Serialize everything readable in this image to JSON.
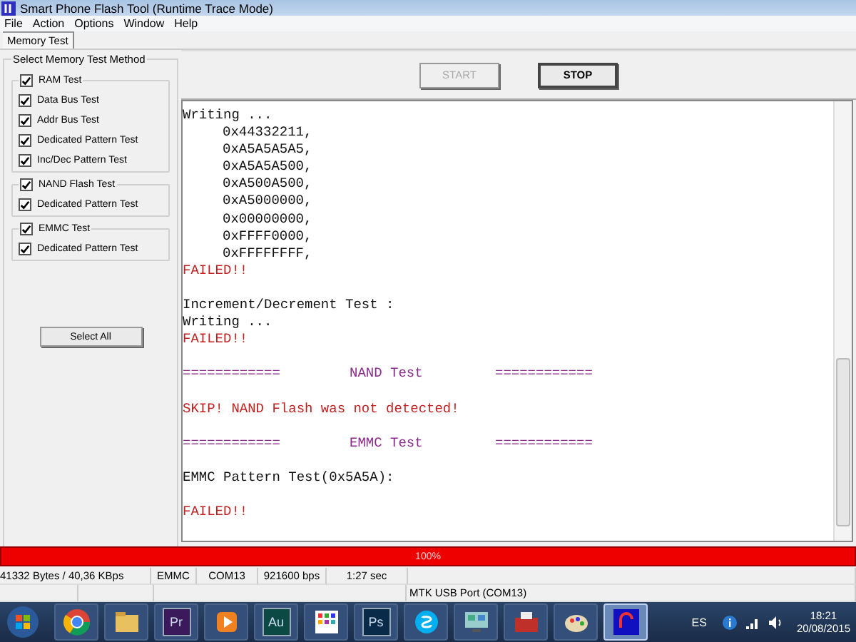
{
  "window": {
    "title": "Smart Phone Flash Tool (Runtime Trace Mode)"
  },
  "menu": [
    "File",
    "Action",
    "Options",
    "Window",
    "Help"
  ],
  "tabs": [
    {
      "label": "Memory Test",
      "selected": true
    }
  ],
  "method_panel": {
    "title": "Select Memory Test Method",
    "groups": [
      {
        "label": "RAM Test",
        "checked": true,
        "items": [
          {
            "label": "Data Bus Test",
            "checked": true
          },
          {
            "label": "Addr Bus Test",
            "checked": true
          },
          {
            "label": "Dedicated Pattern Test",
            "checked": true
          },
          {
            "label": "Inc/Dec Pattern Test",
            "checked": true
          }
        ]
      },
      {
        "label": "NAND Flash Test",
        "checked": true,
        "items": [
          {
            "label": "Dedicated Pattern Test",
            "checked": true
          }
        ]
      },
      {
        "label": "EMMC Test",
        "checked": true,
        "items": [
          {
            "label": "Dedicated Pattern Test",
            "checked": true
          }
        ]
      }
    ],
    "select_all": "Select All"
  },
  "buttons": [
    {
      "label": "START",
      "disabled": true
    },
    {
      "label": "STOP",
      "disabled": false
    }
  ],
  "log": [
    {
      "kind": "text",
      "text": "Writing ..."
    },
    {
      "kind": "value",
      "text": "0x44332211,"
    },
    {
      "kind": "value",
      "text": "0xA5A5A5A5,"
    },
    {
      "kind": "value",
      "text": "0xA5A5A500,"
    },
    {
      "kind": "value",
      "text": "0xA500A500,"
    },
    {
      "kind": "value",
      "text": "0xA5000000,"
    },
    {
      "kind": "value",
      "text": "0x00000000,"
    },
    {
      "kind": "value",
      "text": "0xFFFF0000,"
    },
    {
      "kind": "value",
      "text": "0xFFFFFFFF,"
    },
    {
      "kind": "error",
      "text": "FAILED!!"
    },
    {
      "kind": "spacer"
    },
    {
      "kind": "text",
      "text": "Increment/Decrement Test :"
    },
    {
      "kind": "text",
      "text": "Writing ..."
    },
    {
      "kind": "error",
      "text": "FAILED!!"
    },
    {
      "kind": "spacer"
    },
    {
      "kind": "header",
      "left": "============",
      "title": "NAND Test",
      "right": "============"
    },
    {
      "kind": "spacer"
    },
    {
      "kind": "error",
      "text": "SKIP! NAND Flash was not detected!"
    },
    {
      "kind": "spacer"
    },
    {
      "kind": "header",
      "left": "============",
      "title": "EMMC Test",
      "right": "============"
    },
    {
      "kind": "spacer"
    },
    {
      "kind": "text",
      "text": "EMMC Pattern Test(0x5A5A):"
    },
    {
      "kind": "spacer"
    },
    {
      "kind": "error",
      "text": "FAILED!!"
    }
  ],
  "progress": {
    "level": 1,
    "text": "100%"
  },
  "status_bar": {
    "row_1": [
      "41332 Bytes / 40,36 KBps",
      "EMMC",
      "COM13",
      "921600 bps",
      "1:27 sec"
    ],
    "port": "MTK USB Port (COM13)"
  },
  "taskbar": {
    "apps": [
      {
        "kind": "browser"
      },
      {
        "kind": "folder"
      },
      {
        "kind": "label",
        "text": "Pr",
        "color": "#3a1a5a"
      },
      {
        "kind": "media"
      },
      {
        "kind": "label",
        "text": "Au",
        "color": "#0b4a44"
      },
      {
        "kind": "grid"
      },
      {
        "kind": "label",
        "text": "Ps",
        "color": "#0a2a4a"
      },
      {
        "kind": "chat"
      },
      {
        "kind": "network"
      },
      {
        "kind": "toolbox"
      },
      {
        "kind": "paint"
      },
      {
        "kind": "tool",
        "selected": true
      }
    ],
    "language": "ES",
    "time": "18:21",
    "date": "20/08/2015"
  }
}
